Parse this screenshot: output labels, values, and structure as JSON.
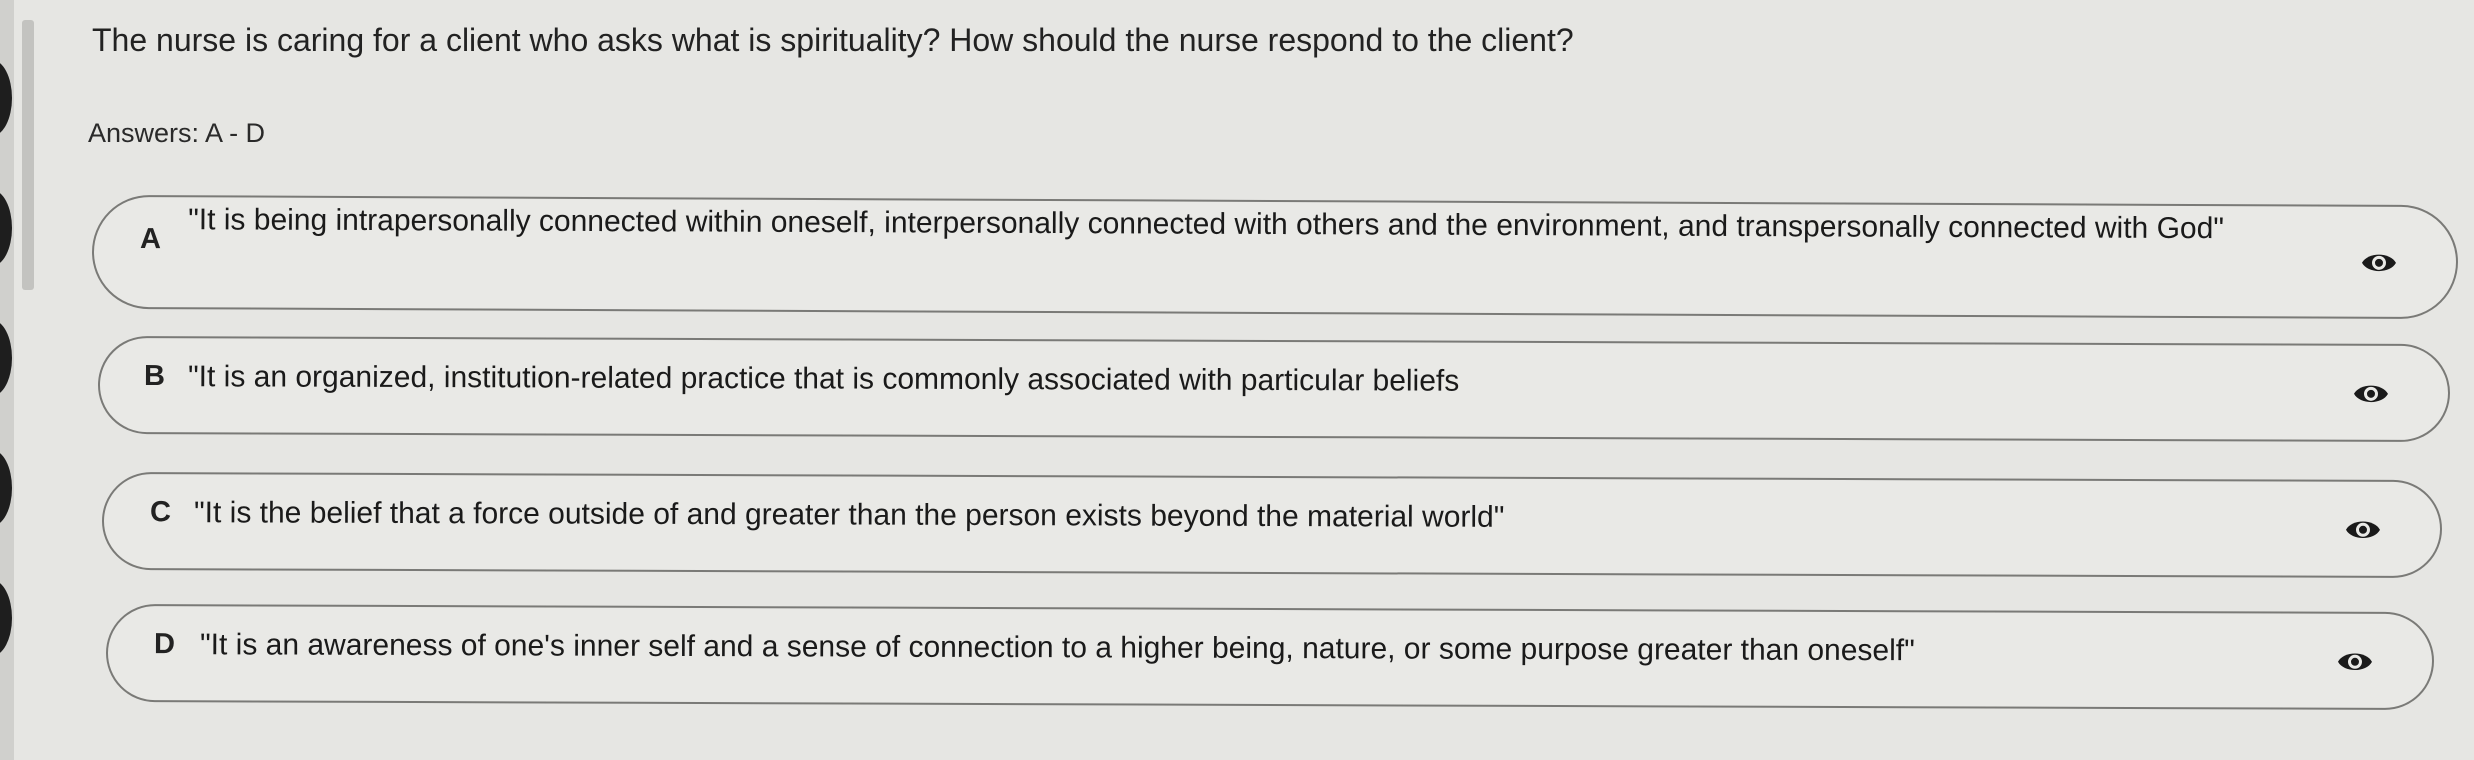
{
  "question": "The nurse is caring for a client who asks what is spirituality? How should the nurse respond to the client?",
  "answers_label": "Answers: A - D",
  "options": [
    {
      "letter": "A",
      "text": "\"It is being intrapersonally connected within oneself, interpersonally connected with others and the environment, and transpersonally connected with God\"",
      "icon": "eye-icon"
    },
    {
      "letter": "B",
      "text": "\"It is an organized, institution-related practice that is commonly associated with particular beliefs",
      "icon": "eye-icon"
    },
    {
      "letter": "C",
      "text": "\"It is the belief that a force outside of and greater than the person exists beyond the material world\"",
      "icon": "eye-icon"
    },
    {
      "letter": "D",
      "text": "\"It is an awareness of one's inner self and a sense of connection to a higher being, nature, or some purpose greater than oneself\"",
      "icon": "eye-icon"
    }
  ],
  "colors": {
    "background": "#e6e6e3",
    "option_border": "#7a7a77",
    "icon": "#1a1a1a"
  }
}
